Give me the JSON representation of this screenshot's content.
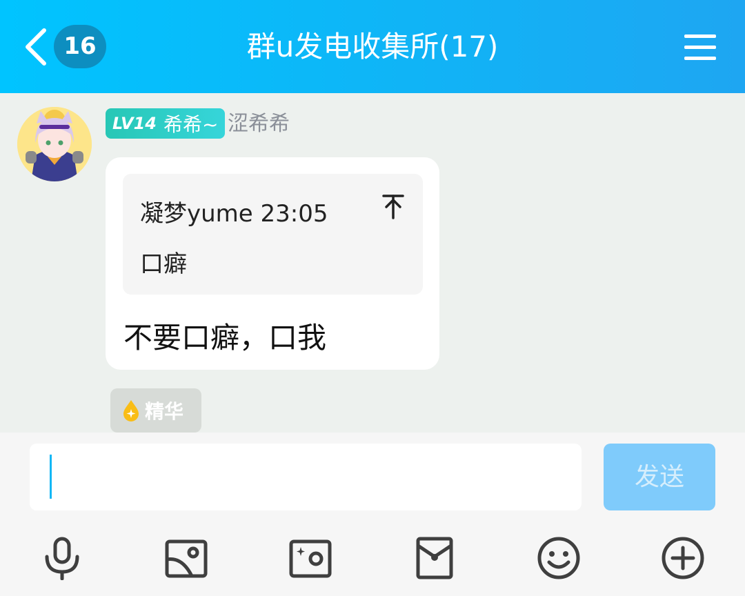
{
  "header": {
    "unread_count": "16",
    "title": "群u发电收集所(17)"
  },
  "message": {
    "level_label": "LV14",
    "badge_name": "希希~",
    "nickname": "涩希希",
    "quote": {
      "author_time": "凝梦yume 23:05",
      "text": "口癖"
    },
    "text": "不要口癖，口我",
    "essence_label": "精华"
  },
  "input": {
    "value": "",
    "send_label": "发送"
  },
  "colors": {
    "header_gradient_start": "#00c4ff",
    "header_gradient_end": "#1ea6f2",
    "level_badge": "#27c7b5",
    "send_button": "#7fcbfb",
    "caret": "#12b7f5"
  },
  "toolbar": [
    "microphone-icon",
    "picture-icon",
    "camera-icon",
    "red-envelope-icon",
    "emoji-icon",
    "plus-icon"
  ]
}
